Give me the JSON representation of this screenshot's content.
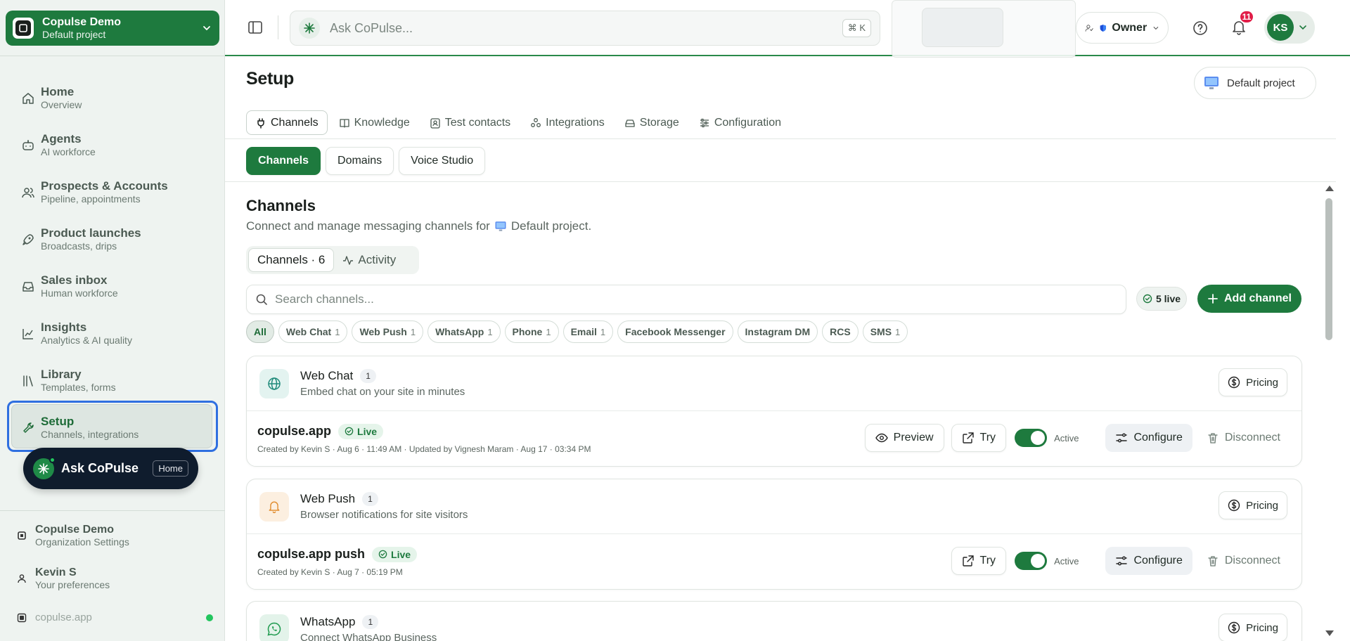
{
  "workspace": {
    "name": "Copulse Demo",
    "project": "Default project"
  },
  "nav": [
    {
      "title": "Home",
      "sub": "Overview",
      "icon": "home-icon"
    },
    {
      "title": "Agents",
      "sub": "AI workforce",
      "icon": "bot-icon"
    },
    {
      "title": "Prospects & Accounts",
      "sub": "Pipeline, appointments",
      "icon": "users-icon"
    },
    {
      "title": "Product launches",
      "sub": "Broadcasts, drips",
      "icon": "rocket-icon"
    },
    {
      "title": "Sales inbox",
      "sub": "Human workforce",
      "icon": "inbox-icon"
    },
    {
      "title": "Insights",
      "sub": "Analytics & AI quality",
      "icon": "chart-icon"
    },
    {
      "title": "Library",
      "sub": "Templates, forms",
      "icon": "library-icon"
    },
    {
      "title": "Setup",
      "sub": "Channels, integrations",
      "icon": "wrench-icon"
    }
  ],
  "ask_pill": {
    "label": "Ask CoPulse",
    "kbd": "Home"
  },
  "footer": {
    "org": {
      "title": "Copulse Demo",
      "sub": "Organization Settings"
    },
    "user": {
      "title": "Kevin S",
      "sub": "Your preferences"
    },
    "domain": "copulse.app"
  },
  "topbar": {
    "search_placeholder": "Ask CoPulse...",
    "search_kbd": "⌘ K",
    "role": "Owner",
    "notifications": "11",
    "avatar": "KS"
  },
  "page": {
    "title": "Setup",
    "project_button": "Default project"
  },
  "tabs": [
    "Channels",
    "Knowledge",
    "Test contacts",
    "Integrations",
    "Storage",
    "Configuration"
  ],
  "subtabs": [
    "Channels",
    "Domains",
    "Voice Studio"
  ],
  "section": {
    "title": "Channels",
    "desc_prefix": "Connect and manage messaging channels for",
    "desc_project": "Default project."
  },
  "inner_tabs": [
    "Channels · 6",
    "Activity"
  ],
  "channel_search_placeholder": "Search channels...",
  "live_count": "5 live",
  "add_channel": "Add channel",
  "filters": [
    {
      "label": "All",
      "count": ""
    },
    {
      "label": "Web Chat",
      "count": "1"
    },
    {
      "label": "Web Push",
      "count": "1"
    },
    {
      "label": "WhatsApp",
      "count": "1"
    },
    {
      "label": "Phone",
      "count": "1"
    },
    {
      "label": "Email",
      "count": "1"
    },
    {
      "label": "Facebook Messenger",
      "count": ""
    },
    {
      "label": "Instagram DM",
      "count": ""
    },
    {
      "label": "RCS",
      "count": ""
    },
    {
      "label": "SMS",
      "count": "1"
    }
  ],
  "labels": {
    "pricing": "Pricing",
    "preview": "Preview",
    "try": "Try",
    "active": "Active",
    "configure": "Configure",
    "disconnect": "Disconnect",
    "live": "Live"
  },
  "cards": [
    {
      "name": "Web Chat",
      "count": "1",
      "tagline": "Embed chat on your site in minutes",
      "instance": "copulse.app",
      "meta": "Created by Kevin S · Aug 6 · 11:49 AM · Updated by Vignesh Maram · Aug 17 · 03:34 PM"
    },
    {
      "name": "Web Push",
      "count": "1",
      "tagline": "Browser notifications for site visitors",
      "instance": "copulse.app push",
      "meta": "Created by Kevin S · Aug 7 · 05:19 PM"
    },
    {
      "name": "WhatsApp",
      "count": "1",
      "tagline": "Connect WhatsApp Business"
    }
  ],
  "colors": {
    "brand": "#1e7a3e",
    "focus": "#2f6fe0",
    "badge": "#e11d48"
  }
}
